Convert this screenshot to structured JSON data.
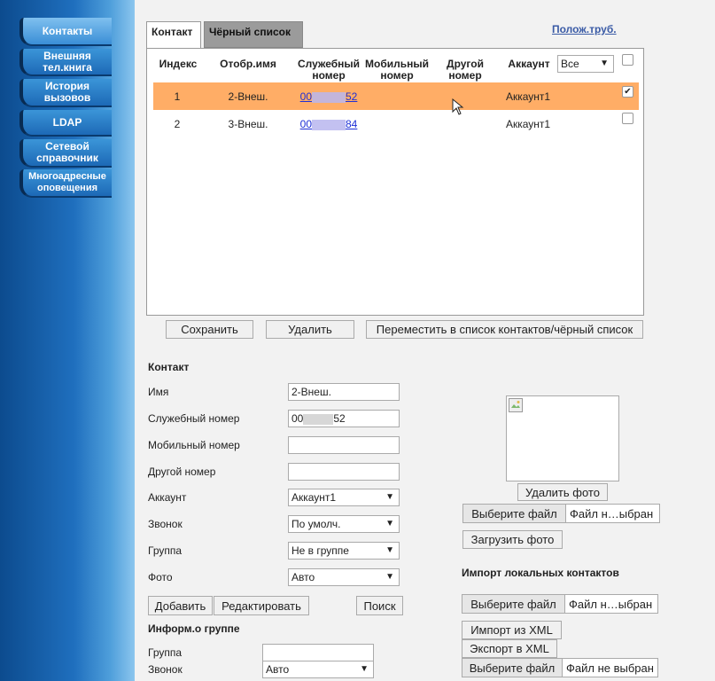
{
  "sidebar": {
    "items": [
      {
        "label": "Контакты"
      },
      {
        "label": "Внешняя тел.книга"
      },
      {
        "label": "История вызовов"
      },
      {
        "label": "LDAP"
      },
      {
        "label": "Сетевой справочник"
      },
      {
        "label": "Многоадресные оповещения"
      }
    ]
  },
  "tabs": [
    {
      "label": "Контакт"
    },
    {
      "label": "Чёрный список"
    }
  ],
  "pos_link": "Полож.труб.",
  "table": {
    "headers": {
      "index": "Индекс",
      "name": "Отобр.имя",
      "office1": "Служебный",
      "office2": "номер",
      "mobile1": "Мобильный",
      "mobile2": "номер",
      "other1": "Другой",
      "other2": "номер",
      "account": "Аккаунт"
    },
    "account_filter": "Все",
    "rows": [
      {
        "index": "1",
        "name": "2-Внеш.",
        "office_prefix": "00",
        "office_suffix": "52",
        "account": "Аккаунт1",
        "checked": true
      },
      {
        "index": "2",
        "name": "3-Внеш.",
        "office_prefix": "00",
        "office_suffix": "84",
        "account": "Аккаунт1",
        "checked": false
      }
    ]
  },
  "buttons": {
    "save": "Сохранить",
    "delete": "Удалить",
    "move": "Переместить в список контактов/чёрный список",
    "add": "Добавить",
    "edit": "Редактировать",
    "search": "Поиск",
    "delete_photo": "Удалить фото",
    "upload_photo": "Загрузить фото",
    "import_xml": "Импорт из XML",
    "export_xml": "Экспорт в XML"
  },
  "contact_form": {
    "title": "Контакт",
    "name_label": "Имя",
    "name_value": "2-Внеш.",
    "office_label": "Служебный номер",
    "office_prefix": "00",
    "office_suffix": "52",
    "mobile_label": "Мобильный номер",
    "other_label": "Другой номер",
    "account_label": "Аккаунт",
    "account_value": "Аккаунт1",
    "ring_label": "Звонок",
    "ring_value": "По умолч.",
    "group_label": "Группа",
    "group_value": "Не в группе",
    "photo_label": "Фото",
    "photo_value": "Авто"
  },
  "group_info": {
    "title": "Информ.о группе",
    "group_label": "Группа",
    "ring_label": "Звонок",
    "ring_value": "Авто"
  },
  "file_pickers": {
    "choose": "Выберите файл",
    "photo_status": "Файл н…ыбран",
    "import_status": "Файл н…ыбран",
    "xml_status": "Файл не выбран"
  },
  "import_title": "Импорт локальных контактов"
}
